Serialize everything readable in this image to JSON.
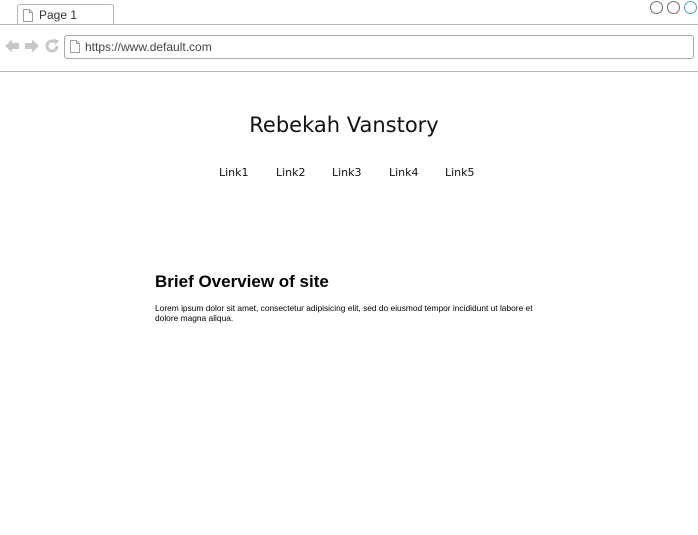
{
  "browser": {
    "tab": {
      "label": "Page 1",
      "icon": "document-icon"
    },
    "window_controls": [
      "circle-button",
      "circle-button",
      "circle-button"
    ],
    "nav": {
      "back_icon": "back-arrow-icon",
      "forward_icon": "forward-arrow-icon",
      "reload_icon": "reload-icon"
    },
    "address_bar": {
      "value": "https://www.default.com",
      "icon": "document-icon"
    },
    "colors": {
      "border": "#b5b5b5",
      "icon_gray": "#c8c8c8",
      "active_control": "#3fa3e0"
    }
  },
  "page": {
    "title": "Rebekah Vanstory",
    "nav_links": [
      "Link1",
      "Link2",
      "Link3",
      "Link4",
      "Link5"
    ],
    "overview": {
      "heading": "Brief Overview of site",
      "body": "Lorem ipsum dolor sit amet, consectetur adipisicing elit, sed do eiusmod tempor incididunt ut labore et dolore magna aliqua."
    }
  }
}
